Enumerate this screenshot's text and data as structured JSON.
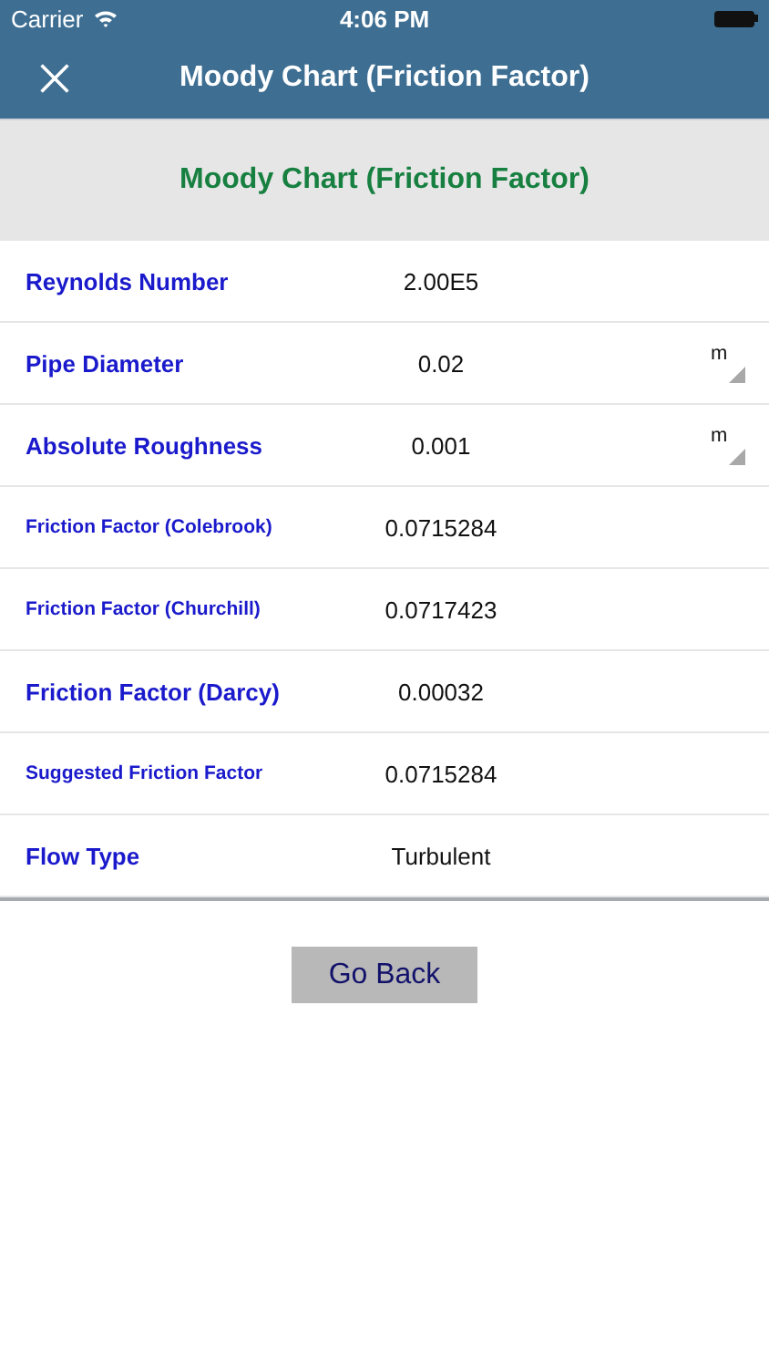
{
  "status_bar": {
    "carrier": "Carrier",
    "time": "4:06 PM"
  },
  "nav_bar": {
    "title": "Moody Chart (Friction Factor)"
  },
  "header": {
    "title": "Moody Chart (Friction Factor)"
  },
  "rows": [
    {
      "kind": "input",
      "label": "Reynolds Number",
      "value": "2.00E5"
    },
    {
      "kind": "unit",
      "label": "Pipe Diameter",
      "value": "0.02",
      "unit": "m"
    },
    {
      "kind": "unit",
      "label": "Absolute Roughness",
      "value": "0.001",
      "unit": "m"
    },
    {
      "kind": "compact",
      "label": "Friction Factor (Colebrook)",
      "value": "0.0715284"
    },
    {
      "kind": "compact",
      "label": "Friction Factor (Churchill)",
      "value": "0.0717423"
    },
    {
      "kind": "input",
      "label": "Friction Factor (Darcy)",
      "value": "0.00032"
    },
    {
      "kind": "compact",
      "label": "Suggested Friction Factor",
      "value": "0.0715284"
    },
    {
      "kind": "input",
      "label": "Flow Type",
      "value": "Turbulent"
    }
  ],
  "buttons": [
    "Go Back"
  ]
}
